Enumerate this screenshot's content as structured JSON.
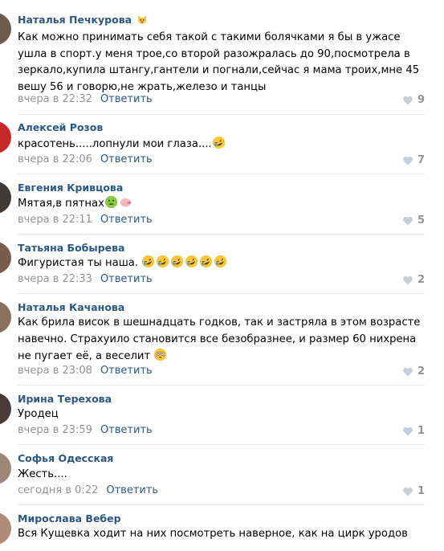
{
  "comments": [
    {
      "author": "Наталья Печкурова",
      "author_emoji": "cat-face-emoji",
      "text": "Как можно принимать себя такой с такими болячками я бы в ужасе ушла в спорт.у меня трое,со второй разожралась до 90,посмотрела в зеркало,купила штангу,гантели и погнали,сейчас я мама троих,мне 45 вешу 56 и говорю,не жрать,железо и танцы",
      "time": "вчера в 22:32",
      "reply": "Ответить",
      "likes": "9",
      "liked": false,
      "avatar_color": "#6b5a4e"
    },
    {
      "author": "Алексей Розов",
      "text": "красотень.....лопнули мои глаза....",
      "emojis": [
        "rolling-on-floor-laughing-emoji"
      ],
      "time": "вчера в 22:06",
      "reply": "Ответить",
      "likes": "7",
      "liked": false,
      "avatar_color": "#c62828"
    },
    {
      "author": "Евгения Кривцова",
      "text": "Мятая,в пятнах",
      "emojis": [
        "nauseated-face-emoji",
        "pig-emoji"
      ],
      "time": "вчера в 22:11",
      "reply": "Ответить",
      "likes": "5",
      "liked": false,
      "avatar_color": "#3e3a36"
    },
    {
      "author": "Татьяна Бобырева",
      "text": "Фигуристая ты наша.",
      "emojis": [
        "rolling-on-floor-laughing-emoji",
        "rolling-on-floor-laughing-emoji",
        "rolling-on-floor-laughing-emoji",
        "rolling-on-floor-laughing-emoji",
        "rolling-on-floor-laughing-emoji",
        "rolling-on-floor-laughing-emoji"
      ],
      "time": "вчера в 22:33",
      "reply": "Ответить",
      "likes": "2",
      "liked": false,
      "avatar_color": "#7a5c4a"
    },
    {
      "author": "Наталья Качанова",
      "text": "Как брила висок в шешнадцать годков, так и застряла в этом возрасте навечно. Страхуило становится все безобразнее, и размер 60 нихрена не пугает её, а веселит",
      "emojis": [
        "flushed-face-emoji"
      ],
      "time": "вчера в 23:08",
      "reply": "Ответить",
      "likes": "2",
      "liked": false,
      "avatar_color": "#8a6f5c"
    },
    {
      "author": "Ирина Терехова",
      "text": "Уродец",
      "time": "вчера в 23:59",
      "reply": "Ответить",
      "likes": "1",
      "liked": false,
      "avatar_color": "#4a3b36"
    },
    {
      "author": "Софья Одесская",
      "text": "Жесть....",
      "time": "сегодня в 0:22",
      "reply": "Ответить",
      "likes": "1",
      "liked": false,
      "avatar_color": "#9c8778"
    },
    {
      "author": "Мирослава Вебер",
      "text": "Вся Кущевка ходит на них посмотреть наверное, как на цирк уродов",
      "time": "",
      "reply": "",
      "likes": "",
      "liked": false,
      "avatar_color": "#b08c78"
    }
  ],
  "colors": {
    "link": "#2a5885",
    "meta": "#939393",
    "separator": "#e7e8ec"
  }
}
